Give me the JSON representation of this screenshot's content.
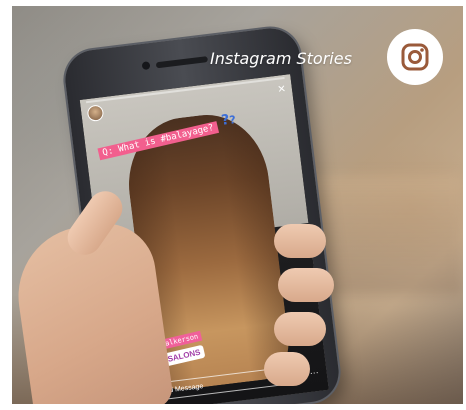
{
  "caption": {
    "text": "Instagram Stories",
    "badge_icon": "instagram-icon",
    "badge_icon_color": "#9a5a3a"
  },
  "story": {
    "username": "",
    "time": "",
    "question_sticker": "Q: What is #balayage?",
    "mention_tag": "#nathaliewalkerson",
    "location_sticker": "NUOVO SALONS",
    "reply_placeholder": "Send Message",
    "accent_pink": "#f25f8e",
    "accent_blue": "#3d6fd8"
  }
}
